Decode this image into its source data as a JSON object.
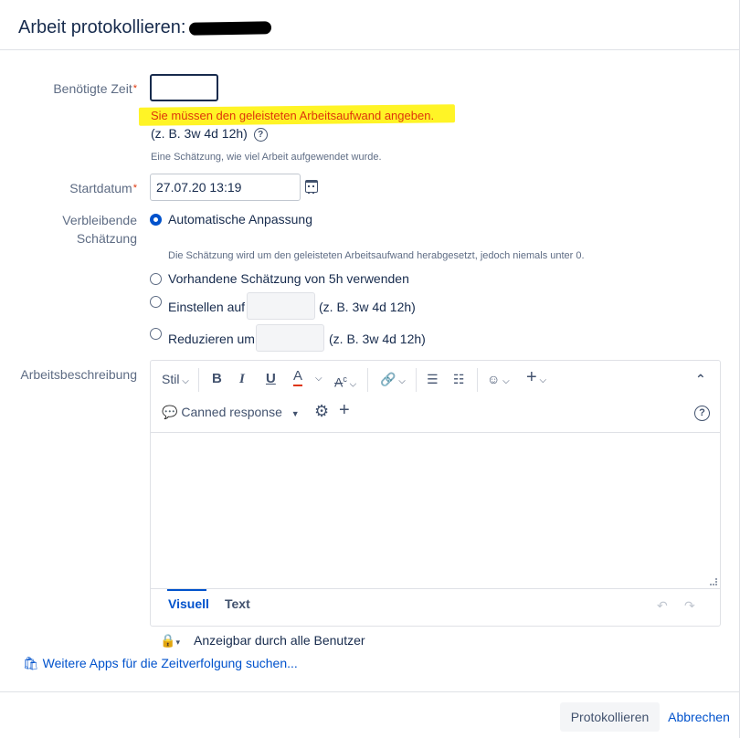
{
  "dialog": {
    "title": "Arbeit protokollieren:"
  },
  "time_spent": {
    "label": "Benötigte Zeit",
    "required_mark": "*",
    "value": "",
    "error": "Sie müssen den geleisteten Arbeitsaufwand angeben.",
    "format_hint": "(z. B. 3w 4d 12h)",
    "help_icon": "?",
    "description": "Eine Schätzung, wie viel Arbeit aufgewendet wurde."
  },
  "start_date": {
    "label": "Startdatum",
    "required_mark": "*",
    "value": "27.07.20 13:19",
    "icon": "calendar-icon"
  },
  "remaining_estimate": {
    "label_line1": "Verbleibende",
    "label_line2": "Schätzung",
    "options": [
      {
        "label": "Automatische Anpassung",
        "checked": true
      },
      {
        "label": "Vorhandene Schätzung von 5h verwenden",
        "checked": false
      },
      {
        "label": "Einstellen auf",
        "checked": false,
        "hint": "(z. B. 3w 4d 12h)"
      },
      {
        "label": "Reduzieren um",
        "checked": false,
        "hint": "(z. B. 3w 4d 12h)"
      }
    ],
    "auto_description": "Die Schätzung wird um den geleisteten Arbeitsaufwand herabgesetzt, jedoch niemals unter 0."
  },
  "work_description": {
    "label": "Arbeitsbeschreibung",
    "toolbar": {
      "style": "Stil",
      "bold": "B",
      "italic": "I",
      "underline": "U",
      "text_color": "A",
      "canned_response": "Canned response",
      "plus": "+",
      "help": "?"
    },
    "tabs": {
      "visual": "Visuell",
      "text": "Text"
    },
    "visibility": "Anzeigbar durch alle Benutzer"
  },
  "more_apps_link": "Weitere Apps für die Zeitverfolgung suchen...",
  "buttons": {
    "submit": "Protokollieren",
    "cancel": "Abbrechen"
  },
  "colors": {
    "accent": "#0052cc",
    "error": "#de350b",
    "highlight": "#fff200"
  }
}
